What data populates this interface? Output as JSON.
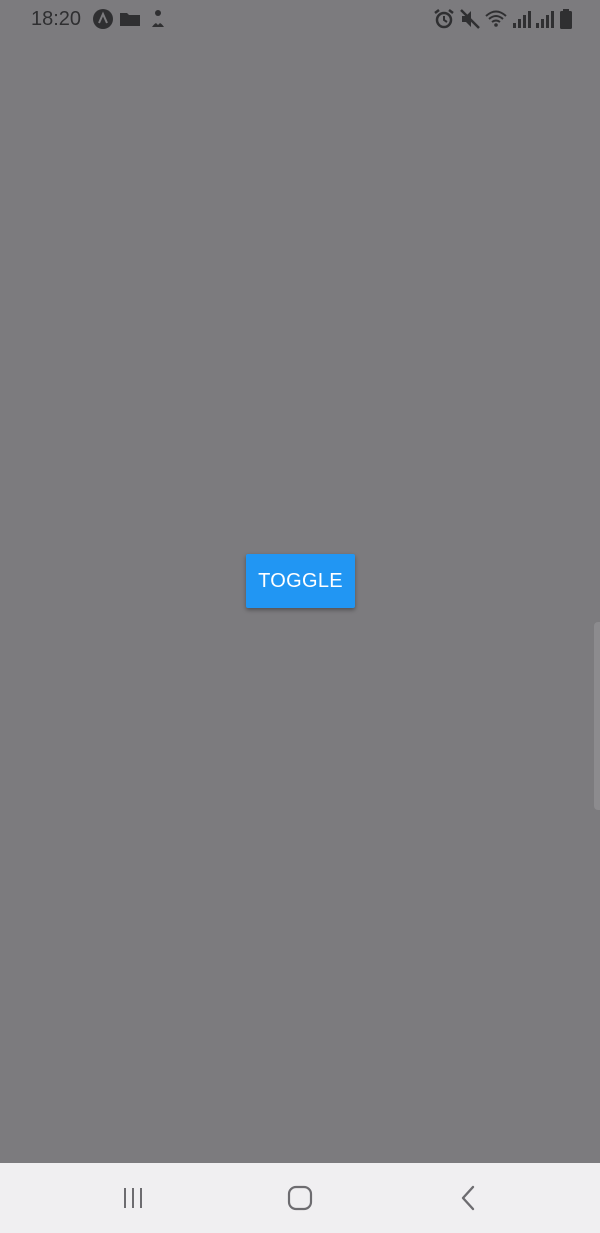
{
  "status_bar": {
    "time": "18:20",
    "left_icons": [
      "app-a-icon",
      "folder-icon",
      "person-download-icon"
    ],
    "right_icons": [
      "alarm-icon",
      "mute-icon",
      "wifi-icon",
      "signal-icon",
      "signal-icon",
      "battery-icon"
    ]
  },
  "main": {
    "toggle_label": "TOGGLE"
  },
  "nav_bar": {
    "buttons": [
      "recent-apps",
      "home",
      "back"
    ]
  },
  "colors": {
    "background": "#7c7b7e",
    "button": "#2196f3",
    "button_text": "#ffffff",
    "nav_bar": "#f0eff1",
    "icon": "#2f2f31"
  }
}
